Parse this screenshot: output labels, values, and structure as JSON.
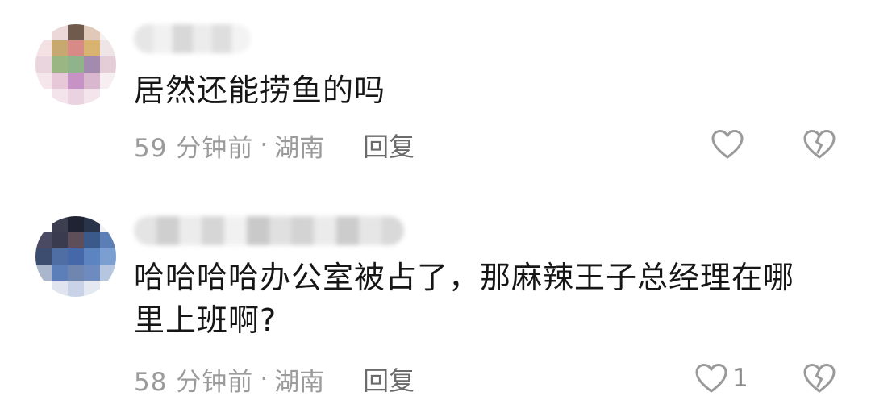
{
  "comments": [
    {
      "text": "居然还能捞鱼的吗",
      "time": "59 分钟前",
      "separator": "·",
      "location": "湖南",
      "reply_label": "回复",
      "like_count": "",
      "avatar_colors": [
        "#ffffff",
        "#ecd8d8",
        "#6f5a4c",
        "#e0c9b9",
        "#f7f1f1",
        "#f3e1e4",
        "#c7a870",
        "#d88a86",
        "#d8b470",
        "#efe4e6",
        "#ead4de",
        "#9ab683",
        "#8fb48c",
        "#a38bb0",
        "#e4cdd6",
        "#f5e6ec",
        "#e6c8d9",
        "#c792c6",
        "#d9b7cf",
        "#f7eef2",
        "#ffffff",
        "#f3e3ea",
        "#e9d3e0",
        "#f4e4ec",
        "#ffffff"
      ],
      "name_colors": [
        "#e6e6e6",
        "#f1f1f1",
        "#d8d8d8",
        "#ececec",
        "#dedede",
        "#f3f3f3"
      ]
    },
    {
      "text": "哈哈哈哈办公室被占了，那麻辣王子总经理在哪里上班啊?",
      "time": "58 分钟前",
      "separator": "·",
      "location": "湖南",
      "reply_label": "回复",
      "like_count": "1",
      "avatar_colors": [
        "#ffffff",
        "#3d3f51",
        "#1f2333",
        "#2a3448",
        "#f2f2f5",
        "#4a4b63",
        "#3a3b4e",
        "#5e4e5a",
        "#3a5a8c",
        "#5a7eb5",
        "#3d4d70",
        "#4f6ea3",
        "#4569a8",
        "#5c84c0",
        "#7b9fd0",
        "#aab6cc",
        "#5d7fb9",
        "#6f87b0",
        "#6e8bc0",
        "#b6c6e0",
        "#ffffff",
        "#dfe4ef",
        "#c9d2e6",
        "#e4e8f1",
        "#ffffff"
      ],
      "name_colors": [
        "#e4e4e4",
        "#cfcfcf",
        "#ececec",
        "#d6d6d6",
        "#f1f1f1",
        "#c9c9c9",
        "#e0e0e0",
        "#d3d3d3",
        "#ebebeb",
        "#cccccc",
        "#e6e6e6",
        "#d9d9d9"
      ]
    }
  ]
}
